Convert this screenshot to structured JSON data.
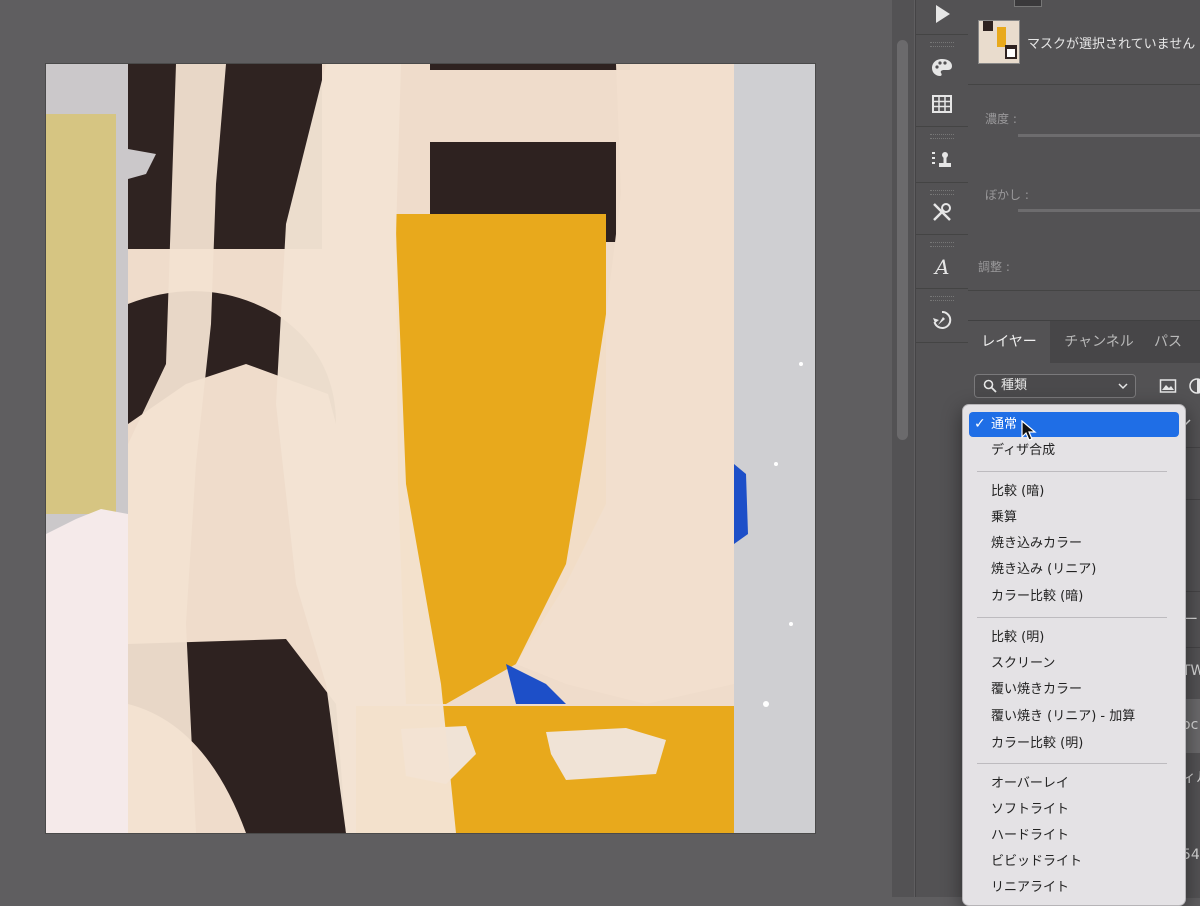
{
  "properties": {
    "mask_label": "マスクが選択されていません",
    "density_label": "濃度 :",
    "feather_label": "ぼかし :",
    "adjust_label": "調整 :"
  },
  "layers_panel": {
    "tabs": [
      "レイヤー",
      "チャンネル",
      "パス"
    ],
    "active_tab": "レイヤー",
    "kind_filter": "種類",
    "edge_fragments": [
      "ー",
      "TW",
      "oc",
      "ィル",
      "54"
    ]
  },
  "blend_menu": {
    "selected": "通常",
    "groups": [
      [
        "通常",
        "ディザ合成"
      ],
      [
        "比較 (暗)",
        "乗算",
        "焼き込みカラー",
        "焼き込み (リニア)",
        "カラー比較 (暗)"
      ],
      [
        "比較 (明)",
        "スクリーン",
        "覆い焼きカラー",
        "覆い焼き (リニア) - 加算",
        "カラー比較 (明)"
      ],
      [
        "オーバーレイ",
        "ソフトライト",
        "ハードライト",
        "ビビッドライト",
        "リニアライト"
      ]
    ]
  },
  "colors": {
    "workspace": "#5f5e60",
    "panel": "#535254",
    "menu_selected": "#1f6ee6",
    "art_yellow": "#e8a91c",
    "art_paper": "#efdccb",
    "art_dark": "#2e2220"
  },
  "tools": [
    "play-icon",
    "palette-icon",
    "grid-icon",
    "stamp-list-icon",
    "tools-icon",
    "type-a-icon",
    "history-brush-icon"
  ]
}
